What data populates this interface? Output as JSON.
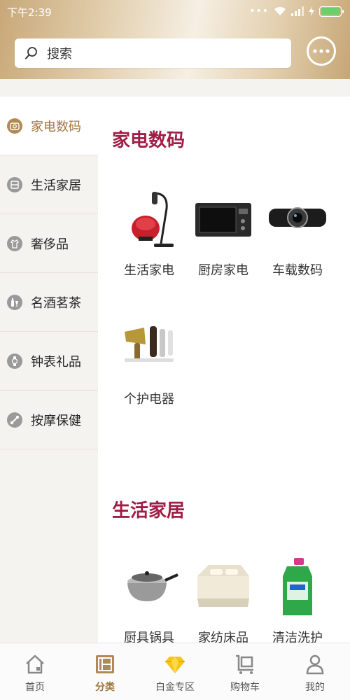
{
  "status_bar": {
    "time": "下午2:39",
    "dots": "•••"
  },
  "search": {
    "placeholder": "搜索"
  },
  "sidebar": {
    "items": [
      {
        "label": "家电数码",
        "icon": "camera-icon",
        "active": true
      },
      {
        "label": "生活家居",
        "icon": "home-goods-icon",
        "active": false
      },
      {
        "label": "奢侈品",
        "icon": "coat-icon",
        "active": false
      },
      {
        "label": "名酒茗茶",
        "icon": "wine-icon",
        "active": false
      },
      {
        "label": "钟表礼品",
        "icon": "watch-icon",
        "active": false
      },
      {
        "label": "按摩保健",
        "icon": "massage-icon",
        "active": false
      }
    ]
  },
  "sections": [
    {
      "title": "家电数码",
      "items": [
        {
          "label": "生活家电",
          "icon": "vacuum-cleaner-image"
        },
        {
          "label": "厨房家电",
          "icon": "microwave-image"
        },
        {
          "label": "车载数码",
          "icon": "webcam-image"
        },
        {
          "label": "个护电器",
          "icon": "hair-dryer-image"
        }
      ]
    },
    {
      "title": "生活家居",
      "items": [
        {
          "label": "厨具锅具",
          "icon": "pot-image"
        },
        {
          "label": "家纺床品",
          "icon": "bedding-image"
        },
        {
          "label": "清洁洗护",
          "icon": "detergent-image"
        }
      ]
    }
  ],
  "bottom_nav": {
    "items": [
      {
        "label": "首页",
        "icon": "home-icon",
        "active": false
      },
      {
        "label": "分类",
        "icon": "category-icon",
        "active": true
      },
      {
        "label": "白金专区",
        "icon": "diamond-icon",
        "active": false
      },
      {
        "label": "购物车",
        "icon": "cart-icon",
        "active": false
      },
      {
        "label": "我的",
        "icon": "user-icon",
        "active": false
      }
    ]
  },
  "colors": {
    "accent_gold": "#a0763e",
    "section_title": "#9e1e44",
    "battery": "#6ad067"
  }
}
